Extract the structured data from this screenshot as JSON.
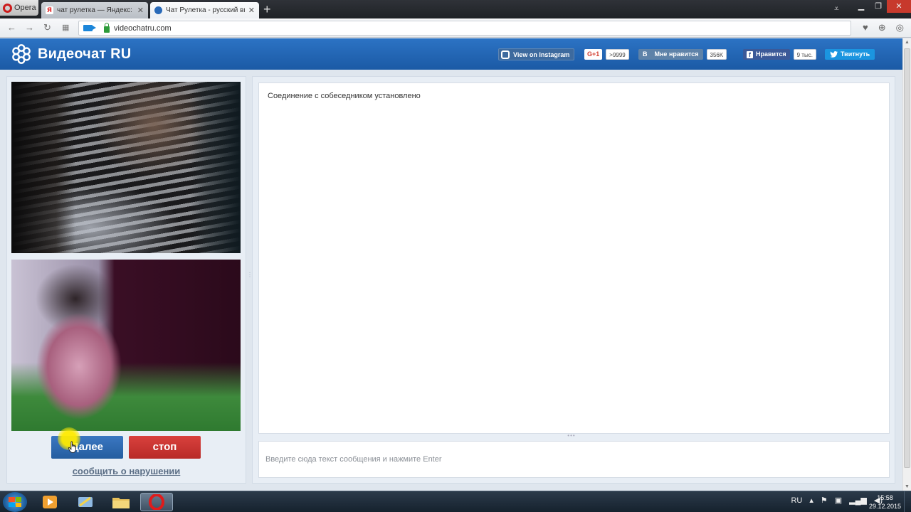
{
  "browser": {
    "opera_label": "Opera",
    "tabs": [
      {
        "title": "чат рулетка — Яндекс: на",
        "close": "✕"
      },
      {
        "title": "Чат Рулетка - русский вид",
        "close": "✕"
      }
    ],
    "new_tab": "+",
    "url": "videochatru.com"
  },
  "site": {
    "title": "Видеочат RU",
    "instagram_label": "View on Instagram",
    "gplus_label": "G+1",
    "gplus_count": ">9999",
    "vk_letter": "В",
    "vk_label": "Мне нравится",
    "vk_count": "356K",
    "fb_letter": "f",
    "fb_label": "Нравится",
    "fb_count": "9 тыс.",
    "tw_label": "Твитнуть"
  },
  "controls": {
    "next_label": "Далее",
    "stop_label": "стоп",
    "report_label": "сообщить о нарушении"
  },
  "chat": {
    "messages": [
      "Соединение с собеседником установлено"
    ],
    "input_placeholder": "Введите сюда текст сообщения и нажмите Enter"
  },
  "taskbar": {
    "lang": "RU",
    "time": "15:58",
    "date": "29.12.2015"
  },
  "colors": {
    "header_blue": "#1f61ad",
    "next_blue": "#2f6bb3",
    "stop_red": "#c7322f"
  }
}
